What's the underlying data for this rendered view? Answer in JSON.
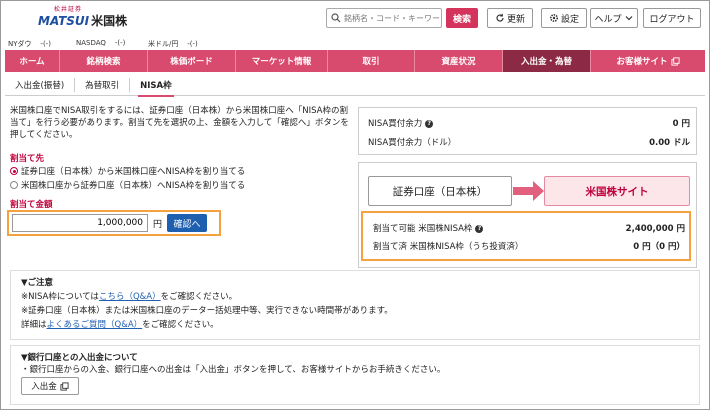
{
  "logo": {
    "small": "松井証券",
    "brand": "MATSUI",
    "kanji": "米国株"
  },
  "header": {
    "search_placeholder": "銘柄名・コード・キーワード",
    "search_button": "検索",
    "refresh_label": "更新",
    "settings_label": "設定",
    "help_label": "ヘルプ",
    "logout_label": "ログアウト"
  },
  "ticker": [
    {
      "name": "NYダウ",
      "value": "-(-)"
    },
    {
      "name": "NASDAQ",
      "value": "-(-)"
    },
    {
      "name": "米ドル/円",
      "value": "-(-)"
    }
  ],
  "nav": {
    "items": [
      "ホーム",
      "銘柄検索",
      "株価ボード",
      "マーケット情報",
      "取引",
      "資産状況",
      "入出金・為替",
      "お客様サイト"
    ]
  },
  "subtabs": [
    "入出金(振替)",
    "為替取引",
    "NISA枠"
  ],
  "intro": "米国株口座でNISA取引をするには、証券口座（日本株）から米国株口座へ「NISA枠の割当て」を行う必要があります。割当て先を選択の上、金額を入力して「確認へ」ボタンを押してください。",
  "allocation": {
    "label_dest": "割当て先",
    "option1": "証券口座（日本株）から米国株口座へNISA枠を割り当てる",
    "option2": "米国株口座から証券口座（日本株）へNISA枠を割り当てる",
    "label_amount": "割当て金額",
    "amount_value": "1,000,000",
    "unit": "円",
    "confirm_button": "確認へ"
  },
  "buying_power": {
    "row1_label": "NISA買付余力",
    "row1_value": "0 円",
    "row2_label": "NISA買付余力（ドル）",
    "row2_value": "0.00 ドル"
  },
  "accounts": {
    "left": "証券口座（日本株）",
    "right": "米国株サイト"
  },
  "alloc_status": {
    "row1_label": "割当て可能 米国株NISA枠",
    "row1_value": "2,400,000 円",
    "row2_label": "割当て済 米国株NISA枠（うち投資済）",
    "row2_value": "0 円（0 円）"
  },
  "notes": {
    "title": "▼ご注意",
    "line1_pre": "※NISA枠については",
    "line1_link": "こちら（Q&A）",
    "line1_post": "をご確認ください。",
    "line2": "※証券口座（日本株）または米国株口座のデーター括処理中等、実行できない時間帯があります。",
    "line3_pre": "詳細は",
    "line3_link": "よくあるご質問（Q&A）",
    "line3_post": "をご確認ください。"
  },
  "bank": {
    "title": "▼銀行口座との入出金について",
    "line": "・銀行口座からの入金、銀行口座への出金は「入出金」ボタンを押して、お客様サイトからお手続きください。",
    "button": "入出金"
  },
  "colors": {
    "brand": "#d84a6e",
    "nav_active": "#8c2a45",
    "highlight": "#f3a23f",
    "link": "#1f5fb0"
  }
}
